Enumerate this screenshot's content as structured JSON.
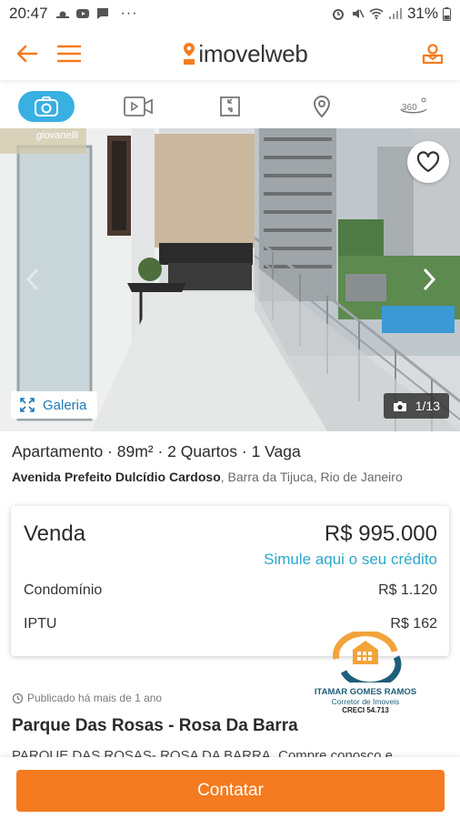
{
  "status_bar": {
    "time": "20:47",
    "battery": "31%"
  },
  "app": {
    "logo_text": "imovelweb",
    "accent_color": "#f47b1f"
  },
  "media_tabs": [
    {
      "name": "photos-icon",
      "active": true
    },
    {
      "name": "video-icon",
      "active": false
    },
    {
      "name": "floorplan-icon",
      "active": false
    },
    {
      "name": "map-pin-icon",
      "active": false
    },
    {
      "name": "tour-360-icon",
      "active": false
    }
  ],
  "photo": {
    "watermark": "giovanelli",
    "gallery_label": "Galeria",
    "counter": "1/13"
  },
  "listing": {
    "title": "Apartamento · 89m² · 2 Quartos · 1 Vaga",
    "street": "Avenida Prefeito Dulcídio Cardoso",
    "area": ", Barra da Tijuca, Rio de Janeiro",
    "operation": "Venda",
    "price": "R$ 995.000",
    "credit_link": "Simule aqui o seu crédito",
    "fees": [
      {
        "label": "Condomínio",
        "value": "R$ 1.120"
      },
      {
        "label": "IPTU",
        "value": "R$ 162"
      }
    ],
    "published": "Publicado há mais de 1 ano",
    "headline": "Parque Das Rosas - Rosa Da Barra",
    "description": "PARQUE DAS ROSAS- ROSA DA BARRA. Compre conosco e"
  },
  "advertiser": {
    "name": "ITAMAR GOMES RAMOS",
    "subtitle": "Corretor de Imoveis",
    "creci": "CRECI 54.713"
  },
  "cta": {
    "contact_label": "Contatar"
  }
}
